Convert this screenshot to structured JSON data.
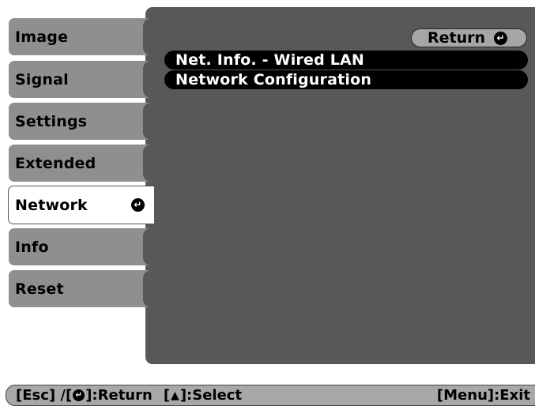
{
  "tabs": [
    {
      "label": "Image",
      "active": false
    },
    {
      "label": "Signal",
      "active": false
    },
    {
      "label": "Settings",
      "active": false
    },
    {
      "label": "Extended",
      "active": false
    },
    {
      "label": "Network",
      "active": true
    },
    {
      "label": "Info",
      "active": false
    },
    {
      "label": "Reset",
      "active": false
    }
  ],
  "panel": {
    "return_label": "Return",
    "items": [
      {
        "label": "Net. Info. - Wired LAN"
      },
      {
        "label": "Network Configuration"
      }
    ]
  },
  "footer": {
    "esc": "[Esc] /[",
    "return": "]:Return",
    "select_open": "[",
    "select": "]:Select",
    "exit": "[Menu]:Exit"
  },
  "icons": {
    "enter": "enter-icon",
    "updown": "up-down-arrow-icon"
  }
}
